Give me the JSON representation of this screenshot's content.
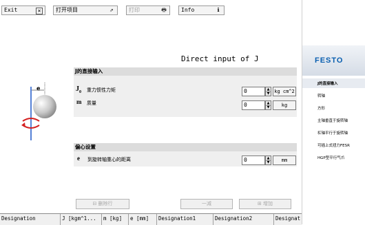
{
  "toolbar": {
    "exit_label": "Exit",
    "open_project_label": "打开项目",
    "print_label": "打印",
    "info_label": "Info"
  },
  "main": {
    "title": "Direct input of J",
    "section1_title": "J的直接输入",
    "j0_symbol": "J",
    "j0_subscript": "0",
    "j0_label": "重力惯性力矩",
    "j0_value": "0",
    "j0_unit": "kg cm^2",
    "m_symbol": "m",
    "m_label": "质量",
    "m_value": "0",
    "m_unit": "kg",
    "diagram_e": "e",
    "section2_title": "偏心设置",
    "e_symbol": "e",
    "e_label": "到旋转轴重心的距离",
    "e_value": "0",
    "e_unit": "mm",
    "delete_row_label": "删除行",
    "minus_label": "一减",
    "add_label": "增加"
  },
  "table": {
    "columns": [
      "Designation",
      "J [kgm^1...",
      "m [kg]",
      "e [mm]",
      "Designation1",
      "Designation2",
      "Designat"
    ]
  },
  "sidebar": {
    "logo": "FESTO",
    "items": [
      "J的直接输入",
      "转轴",
      "方形",
      "主轴垂直于旋转轴",
      "杠轴平行于旋转轴",
      "可插上式扭力FESR",
      "HGP型平行气爪"
    ]
  },
  "colors": {
    "accent": "#0a5fb0",
    "section_bar": "#dcdcdc",
    "arrow_red": "#d42020",
    "axis_blue": "#1a55c8"
  }
}
